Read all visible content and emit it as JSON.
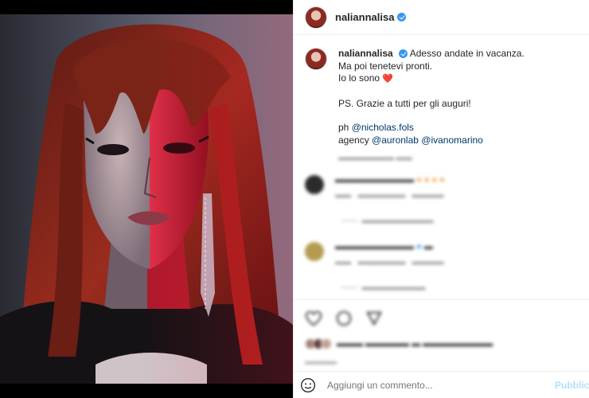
{
  "post": {
    "username": "naliannalisa",
    "verified": true,
    "caption_lines": [
      "Adesso andate in vacanza.",
      "Ma poi tenetevi pronti.",
      "Io lo sono"
    ],
    "heart_emoji": "❤️",
    "ps_line": "PS. Grazie a tutti per gli auguri!",
    "ph_label": "ph",
    "ph_mention": "@nicholas.fols",
    "agency_label": "agency",
    "agency_mentions": [
      "@auronlab",
      "@ivanomarino"
    ]
  },
  "comment_box": {
    "placeholder": "Aggiungi un commento...",
    "publish_label": "Pubblica"
  },
  "colors": {
    "verified": "#3897f0",
    "mention": "#00376b",
    "heart": "#e0245e",
    "publish": "#b2dffc"
  },
  "icons": [
    "heart-icon",
    "comment-icon",
    "share-icon",
    "emoji-icon",
    "verified-badge-icon"
  ]
}
